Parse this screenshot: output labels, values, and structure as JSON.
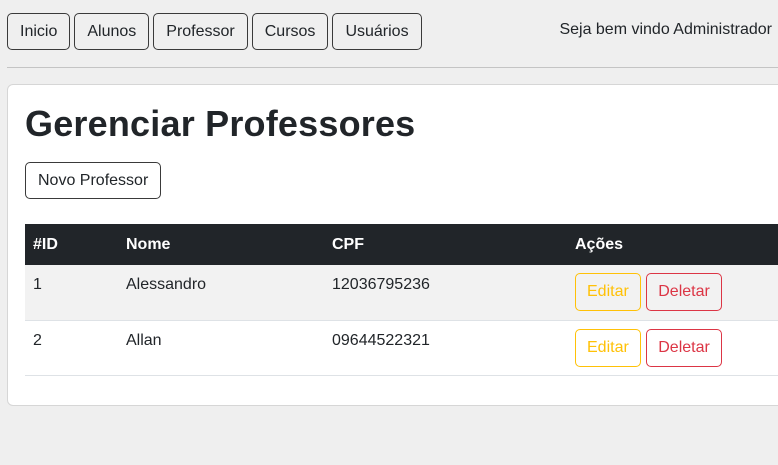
{
  "nav": {
    "items": [
      {
        "label": "Inicio"
      },
      {
        "label": "Alunos"
      },
      {
        "label": "Professor"
      },
      {
        "label": "Cursos"
      },
      {
        "label": "Usuários"
      }
    ],
    "welcome": "Seja bem vindo Administrador"
  },
  "main": {
    "title": "Gerenciar Professores",
    "new_button": "Novo Professor",
    "table": {
      "headers": [
        "#ID",
        "Nome",
        "CPF",
        "Ações"
      ],
      "rows": [
        {
          "id": "1",
          "nome": "Alessandro",
          "cpf": "12036795236",
          "edit": "Editar",
          "delete": "Deletar"
        },
        {
          "id": "2",
          "nome": "Allan",
          "cpf": "09644522321",
          "edit": "Editar",
          "delete": "Deletar"
        }
      ]
    }
  },
  "colors": {
    "background": "#efefef",
    "table_header": "#212529",
    "edit": "#ffc107",
    "delete": "#dc3545"
  }
}
